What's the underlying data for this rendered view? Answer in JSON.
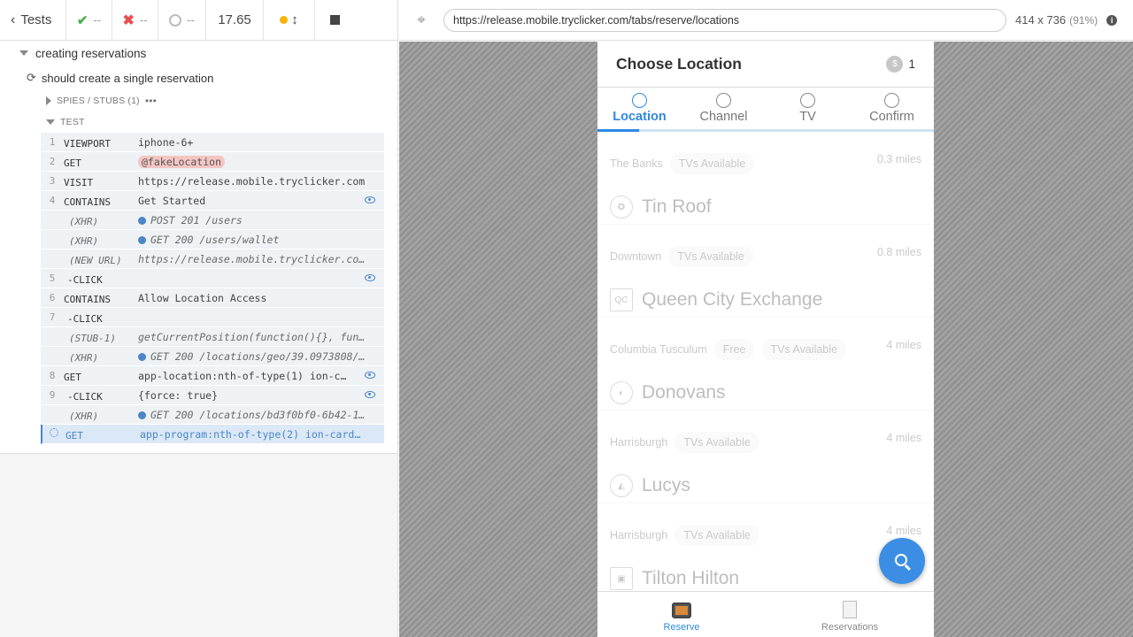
{
  "runner": {
    "tests_label": "Tests",
    "passed_count": "--",
    "failed_count": "--",
    "pending_count": "--",
    "duration": "17.65",
    "suite_title": "creating reservations",
    "test_title": "should create a single reservation",
    "spies_label": "SPIES / STUBS (1)",
    "more_label": "•••",
    "test_hook_label": "TEST",
    "commands": [
      {
        "num": "1",
        "name": "VIEWPORT",
        "msg": "iphone-6+",
        "type": "cmd"
      },
      {
        "num": "2",
        "name": "GET",
        "msg": "@fakeLocation",
        "type": "alias"
      },
      {
        "num": "3",
        "name": "VISIT",
        "msg": "https://release.mobile.tryclicker.com",
        "type": "cmd"
      },
      {
        "num": "4",
        "name": "CONTAINS",
        "msg": "Get Started",
        "type": "cmd",
        "eye": true
      },
      {
        "num": "",
        "name": "(XHR)",
        "msg": "POST 201 /users",
        "type": "xhr"
      },
      {
        "num": "",
        "name": "(XHR)",
        "msg": "GET 200 /users/wallet",
        "type": "xhr"
      },
      {
        "num": "",
        "name": "(NEW URL)",
        "msg": "https://release.mobile.tryclicker.co…",
        "type": "event"
      },
      {
        "num": "5",
        "name": "-CLICK",
        "msg": "",
        "type": "child",
        "eye": true
      },
      {
        "num": "6",
        "name": "CONTAINS",
        "msg": "Allow Location Access",
        "type": "cmd"
      },
      {
        "num": "7",
        "name": "-CLICK",
        "msg": "",
        "type": "child"
      },
      {
        "num": "",
        "name": "(STUB-1)",
        "msg": "getCurrentPosition(function(){}, fun…",
        "type": "event"
      },
      {
        "num": "",
        "name": "(XHR)",
        "msg": "GET 200 /locations/geo/39.0973808/-…",
        "type": "xhr"
      },
      {
        "num": "8",
        "name": "GET",
        "msg": "app-location:nth-of-type(1) ion-c…",
        "type": "cmd",
        "eye": true
      },
      {
        "num": "9",
        "name": "-CLICK",
        "msg": "{force: true}",
        "type": "child",
        "eye": true
      },
      {
        "num": "",
        "name": "(XHR)",
        "msg": "GET 200 /locations/bd3f0bf0-6b42-11…",
        "type": "xhr"
      },
      {
        "num": "",
        "name": "GET",
        "msg": "app-program:nth-of-type(2) ion-card-…",
        "type": "active"
      }
    ]
  },
  "aut": {
    "url": "https://release.mobile.tryclicker.com/tabs/reserve/locations",
    "viewport_size": "414 x 736",
    "viewport_scale": "(91%)"
  },
  "app": {
    "title": "Choose Location",
    "coin_symbol": "$",
    "coin_count": "1",
    "steps": [
      "Location",
      "Channel",
      "TV",
      "Confirm"
    ],
    "locations": [
      {
        "area": "The Banks",
        "tags": [
          "TVs Available"
        ],
        "distance": "0.3 miles",
        "name": "Tin Roof",
        "logo": "✪"
      },
      {
        "area": "Downtown",
        "tags": [
          "TVs Available"
        ],
        "distance": "0.8 miles",
        "name": "Queen City Exchange",
        "logo": "QC"
      },
      {
        "area": "Columbia Tusculum",
        "tags": [
          "Free",
          "TVs Available"
        ],
        "distance": "4 miles",
        "name": "Donovans",
        "logo": "◐"
      },
      {
        "area": "Harrisburgh",
        "tags": [
          "TVs Available"
        ],
        "distance": "4 miles",
        "name": "Lucys",
        "logo": "◭"
      },
      {
        "area": "Harrisburgh",
        "tags": [
          "TVs Available"
        ],
        "distance": "4 miles",
        "name": "Tilton Hilton",
        "logo": "▣"
      }
    ],
    "tabs": [
      {
        "label": "Reserve",
        "icon": "tv-icon"
      },
      {
        "label": "Reservations",
        "icon": "document-icon"
      }
    ],
    "colors": {
      "accent": "#2d89e5",
      "fab": "#3b8ee3"
    }
  }
}
